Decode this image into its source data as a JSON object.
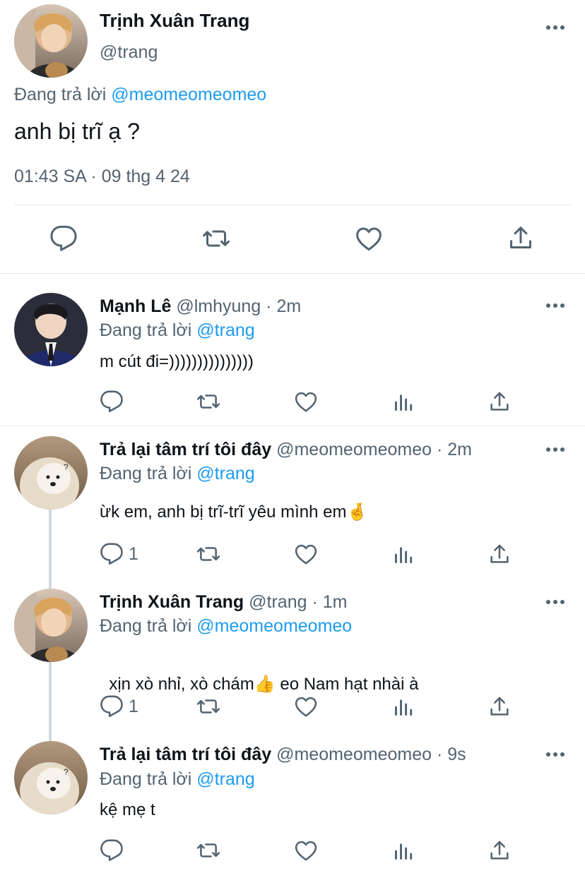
{
  "main_tweet": {
    "author_name": "Trịnh Xuân Trang",
    "author_handle": "@trang",
    "reply_prefix": "Đang trả lời",
    "reply_to": "@meomeomeomeo",
    "text": "anh bị trĩ ạ ?",
    "timestamp": "01:43 SA · 09 thg 4 24"
  },
  "replies": [
    {
      "author_name": "Mạnh Lê",
      "author_handle": "@lmhyung · 2m",
      "reply_prefix": "Đang trả lời",
      "reply_to": "@trang",
      "text": "m cút đi=)))))))))))))))",
      "reply_count": ""
    },
    {
      "author_name": "Trả lại tâm trí tôi đây",
      "author_handle": "@meomeomeomeo · 2m",
      "reply_prefix": "Đang trả lời",
      "reply_to": "@trang",
      "text": "ừk em, anh bị trĩ-trĩ yêu mình em",
      "emoji": "🤞",
      "reply_count": "1"
    },
    {
      "author_name": "Trịnh Xuân Trang",
      "author_handle": "@trang · 1m",
      "reply_prefix": "Đang trả lời",
      "reply_to": "@meomeomeomeo",
      "text_before": "xịn xò nhỉ, xò chám",
      "emoji": "👍",
      "text_after": " eo Nam hạt nhài à",
      "reply_count": "1"
    },
    {
      "author_name": "Trả lại tâm trí tôi đây",
      "author_handle": "@meomeomeomeo · 9s",
      "reply_prefix": "Đang trả lời",
      "reply_to": "@trang",
      "text": "kệ mẹ t",
      "reply_count": ""
    }
  ],
  "colors": {
    "accent": "#1d9bf0",
    "secondary_text": "#536471",
    "border": "#e1e8ed",
    "thread_line": "#cfd9de"
  },
  "icons": [
    "comment-icon",
    "retweet-icon",
    "like-icon",
    "views-icon",
    "share-icon",
    "more-icon"
  ]
}
